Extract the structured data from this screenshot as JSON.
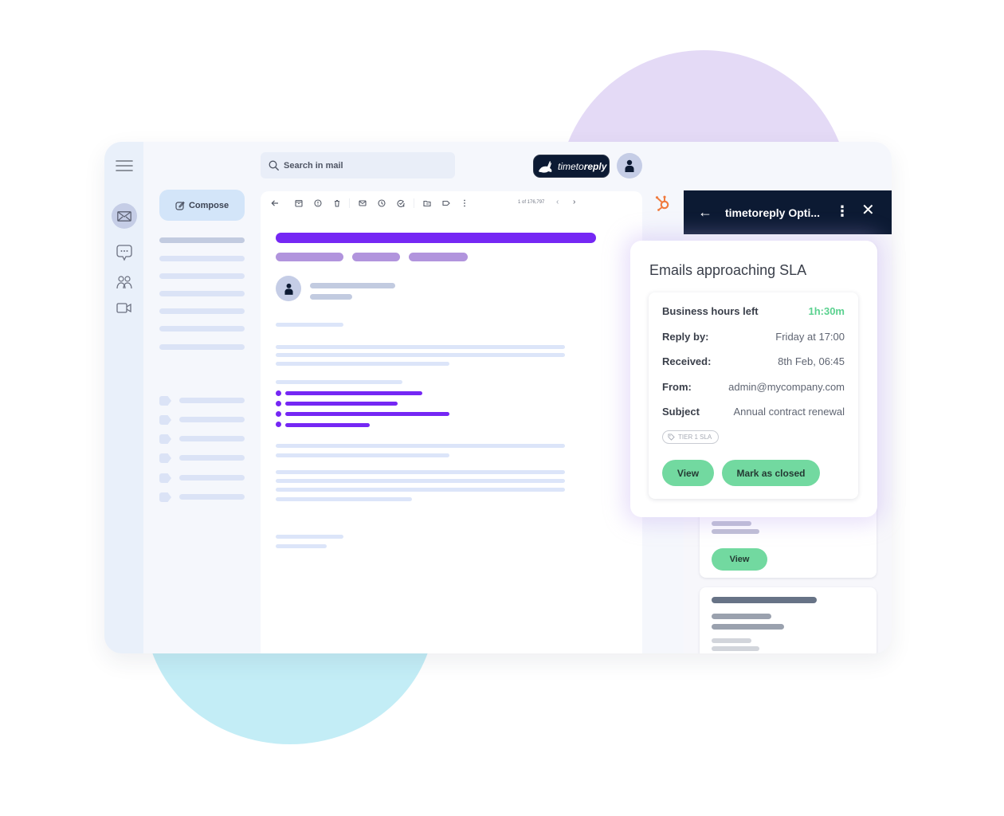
{
  "colors": {
    "accent_purple": "#7527f4",
    "chip_purple": "#b194dd",
    "success_green": "#72d9a0",
    "time_left_green": "#5ad18f",
    "navy": "#0c1a33",
    "hubspot_orange": "#f07b3f",
    "blob_purple": "#e4daf6",
    "blob_cyan": "#c3edf6"
  },
  "rail": {
    "items": [
      {
        "icon": "hamburger-menu-icon"
      },
      {
        "icon": "mail-icon",
        "active": true
      },
      {
        "icon": "chat-icon"
      },
      {
        "icon": "spaces-people-icon"
      },
      {
        "icon": "video-camera-icon"
      }
    ]
  },
  "compose": {
    "icon": "pencil-icon",
    "label": "Compose"
  },
  "search": {
    "icon": "search-icon",
    "placeholder": "Search in mail"
  },
  "brand": {
    "light": "timeto",
    "bold": "reply"
  },
  "reader": {
    "toolbar": {
      "icons": [
        "back-arrow-icon",
        "archive-icon",
        "report-spam-icon",
        "delete-icon",
        "mark-unread-icon",
        "snooze-icon",
        "add-task-icon",
        "move-to-icon",
        "label-icon",
        "more-vertical-icon"
      ],
      "pager_text": "1 of 176,797",
      "prev": "‹",
      "next": "›"
    }
  },
  "addon": {
    "back": "←",
    "title": "timetoreply Opti...",
    "more": "⋮",
    "close": "✕",
    "background_card_button": "View"
  },
  "popup": {
    "title": "Emails approaching SLA",
    "rows": [
      {
        "label": "Business hours left",
        "value": "1h:30m",
        "highlight": true
      },
      {
        "label": "Reply by:",
        "value": "Friday at 17:00"
      },
      {
        "label": "Received:",
        "value": "8th Feb, 06:45"
      },
      {
        "label": "From:",
        "value": "admin@mycompany.com"
      },
      {
        "label": "Subject",
        "value": "Annual contract renewal"
      }
    ],
    "tag": {
      "icon": "tag-icon",
      "label": "TIER 1 SLA"
    },
    "buttons": {
      "view": "View",
      "mark_closed": "Mark as closed"
    }
  }
}
